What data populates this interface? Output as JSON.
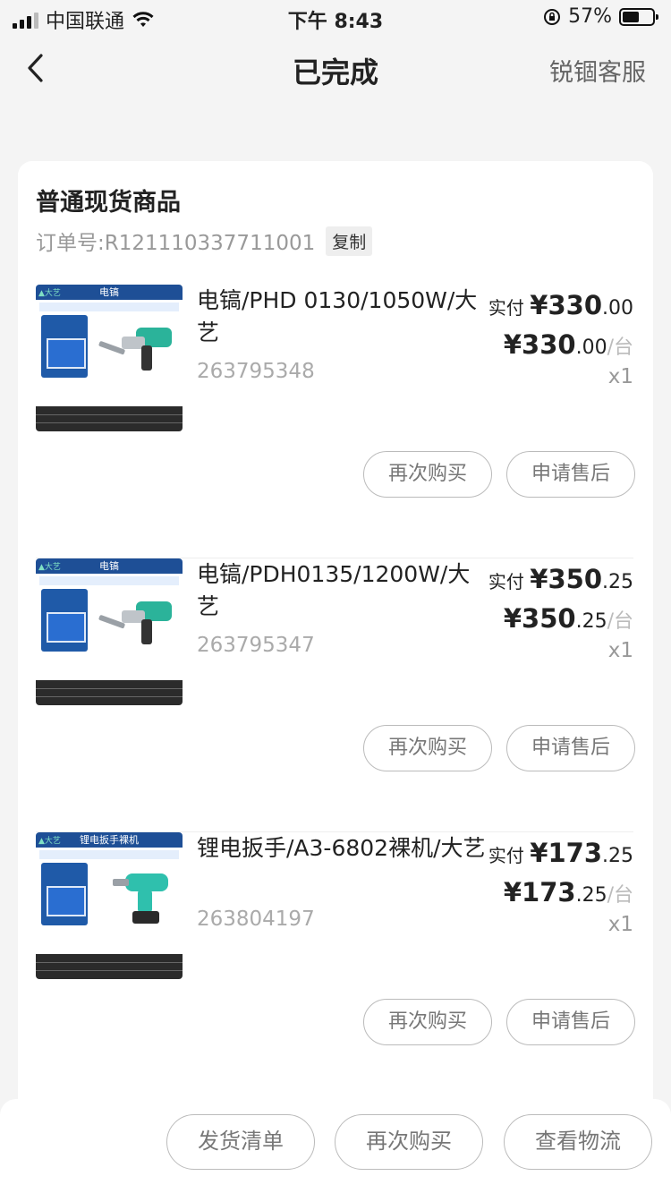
{
  "status_bar": {
    "carrier": "中国联通",
    "time": "下午 8:43",
    "battery": "57%",
    "battery_level": 0.57
  },
  "nav": {
    "title": "已完成",
    "service": "锐锢客服"
  },
  "order": {
    "title": "普通现货商品",
    "order_no": "订单号:R121110337711001",
    "copy_label": "复制"
  },
  "items": [
    {
      "banner": "电镐",
      "name": "电镐/PHD 0130/1050W/大艺",
      "sku": "263795348",
      "pay_label": "实付",
      "pay_int": "¥330",
      "pay_dec": ".00",
      "unit_int": "¥330",
      "unit_dec": ".00",
      "unit_per": "/台",
      "qty": "x1",
      "rebuy": "再次购买",
      "after_sale": "申请售后",
      "tool_color": "#2bb39a"
    },
    {
      "banner": "电镐",
      "name": "电镐/PDH0135/1200W/大艺",
      "sku": "263795347",
      "pay_label": "实付",
      "pay_int": "¥350",
      "pay_dec": ".25",
      "unit_int": "¥350",
      "unit_dec": ".25",
      "unit_per": "/台",
      "qty": "x1",
      "rebuy": "再次购买",
      "after_sale": "申请售后",
      "tool_color": "#2bb39a"
    },
    {
      "banner": "锂电扳手裸机",
      "name": "锂电扳手/A3-6802裸机/大艺",
      "sku": "263804197",
      "pay_label": "实付",
      "pay_int": "¥173",
      "pay_dec": ".25",
      "unit_int": "¥173",
      "unit_dec": ".25",
      "unit_per": "/台",
      "qty": "x1",
      "rebuy": "再次购买",
      "after_sale": "申请售后",
      "tool_color": "#2fc0ad"
    }
  ],
  "bottom": {
    "shipping_list": "发货清单",
    "rebuy": "再次购买",
    "logistics": "查看物流"
  }
}
